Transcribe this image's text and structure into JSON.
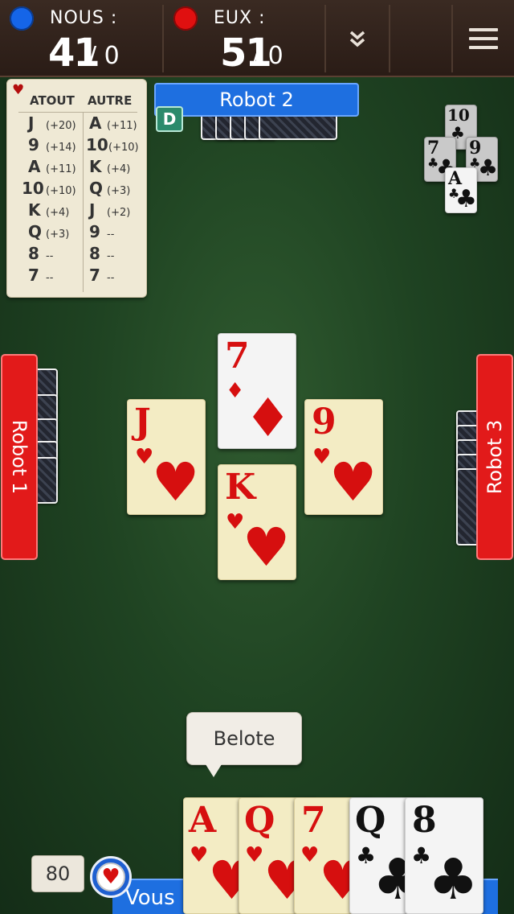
{
  "header": {
    "team_us": {
      "label": "NOUS :",
      "score": "41",
      "points": "/ 0",
      "color": "#1565e8"
    },
    "team_them": {
      "label": "EUX :",
      "score": "51",
      "points": "/ 0",
      "color": "#e01010"
    },
    "expand_icon": "double-chevron-down",
    "menu_icon": "hamburger"
  },
  "values_table": {
    "suit_icon": "heart",
    "trump_header": "ATOUT",
    "other_header": "AUTRE",
    "trump": [
      {
        "rank": "J",
        "pts": "(+20)"
      },
      {
        "rank": "9",
        "pts": "(+14)"
      },
      {
        "rank": "A",
        "pts": "(+11)"
      },
      {
        "rank": "10",
        "pts": "(+10)"
      },
      {
        "rank": "K",
        "pts": "(+4)"
      },
      {
        "rank": "Q",
        "pts": "(+3)"
      },
      {
        "rank": "8",
        "pts": "--"
      },
      {
        "rank": "7",
        "pts": "--"
      }
    ],
    "other": [
      {
        "rank": "A",
        "pts": "(+11)"
      },
      {
        "rank": "10",
        "pts": "(+10)"
      },
      {
        "rank": "K",
        "pts": "(+4)"
      },
      {
        "rank": "Q",
        "pts": "(+3)"
      },
      {
        "rank": "J",
        "pts": "(+2)"
      },
      {
        "rank": "9",
        "pts": "--"
      },
      {
        "rank": "8",
        "pts": "--"
      },
      {
        "rank": "7",
        "pts": "--"
      }
    ]
  },
  "players": {
    "top": "Robot 2",
    "left": "Robot 1",
    "right": "Robot 3",
    "bottom": "Vous",
    "dealer_badge": "D"
  },
  "last_trick": [
    {
      "rank": "10",
      "suit": "♣"
    },
    {
      "rank": "7",
      "suit": "♣"
    },
    {
      "rank": "9",
      "suit": "♣"
    },
    {
      "rank": "A",
      "suit": "♣"
    }
  ],
  "table_cards": {
    "top": {
      "rank": "7",
      "suit": "♦"
    },
    "left": {
      "rank": "J",
      "suit": "♥"
    },
    "right": {
      "rank": "9",
      "suit": "♥"
    },
    "bottom": {
      "rank": "K",
      "suit": "♥"
    }
  },
  "bubble": "Belote",
  "bid": "80",
  "trump_suit": "♥",
  "hand": [
    {
      "rank": "A",
      "suit": "♥"
    },
    {
      "rank": "Q",
      "suit": "♥"
    },
    {
      "rank": "7",
      "suit": "♥"
    },
    {
      "rank": "Q",
      "suit": "♣"
    },
    {
      "rank": "8",
      "suit": "♣"
    }
  ]
}
